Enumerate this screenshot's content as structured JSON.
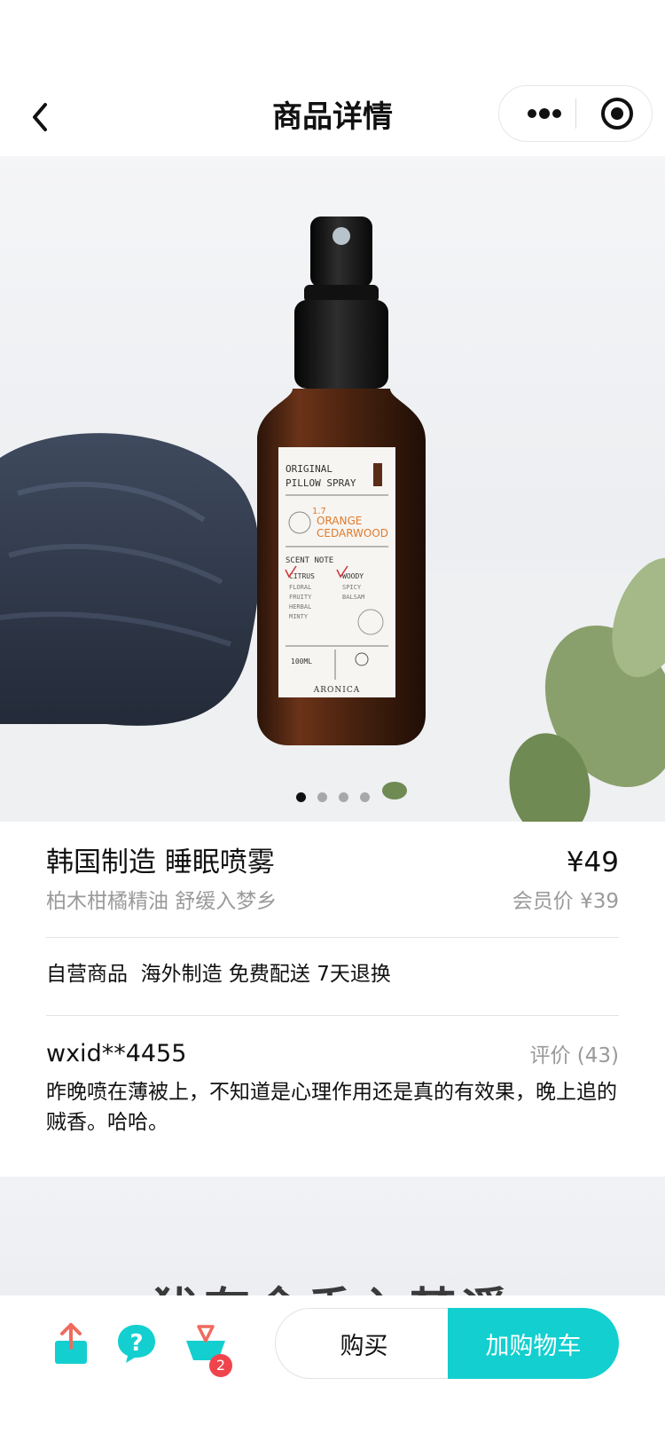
{
  "navbar": {
    "title": "商品详情",
    "back_icon": "chevron-left-icon",
    "more_icon": "more-dots-icon",
    "target_icon": "target-circle-icon"
  },
  "hero": {
    "slide_count": 4,
    "active_slide": 1,
    "label": {
      "line1": "ORIGINAL",
      "line2": "PILLOW SPRAY",
      "number": "1.7",
      "scent1": "ORANGE",
      "scent2": "CEDARWOOD",
      "scent_note": "SCENT NOTE",
      "notes_left": [
        "CITRUS",
        "FLORAL",
        "FRUITY",
        "HERBAL",
        "MINTY"
      ],
      "notes_right": [
        "WOODY",
        "SPICY",
        "BALSAM"
      ],
      "volume": "100ML",
      "brand": "ARONICA"
    }
  },
  "product": {
    "title": "韩国制造 睡眠喷雾",
    "price": "¥49",
    "subtitle": "柏木柑橘精油 舒缓入梦乡",
    "member_price": "会员价 ¥39",
    "tags": "自营商品  海外制造 免费配送 7天退换"
  },
  "review": {
    "user": "wxid**4455",
    "count_label": "评价 (43)",
    "text": "昨晚喷在薄被上，不知道是心理作用还是真的有效果，晚上追的贼香。哈哈。"
  },
  "banner": {
    "text": "犹有余香入梦遥"
  },
  "bottom_bar": {
    "share_icon": "share-icon",
    "help_icon": "help-icon",
    "cart_icon": "cart-icon",
    "cart_badge": "2",
    "buy_label": "购买",
    "add_cart_label": "加购物车",
    "accent_color": "#14cfcf"
  }
}
